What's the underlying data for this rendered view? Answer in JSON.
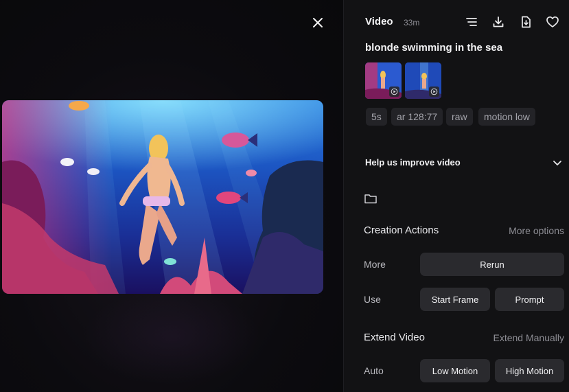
{
  "header": {
    "title": "Video",
    "time": "33m"
  },
  "icons": {
    "close": "close-icon",
    "menu": "lines-icon",
    "download": "download-icon",
    "save": "file-download-icon",
    "like": "heart-icon",
    "folder": "folder-icon",
    "expand": "chevron-down-icon",
    "play": "play-icon"
  },
  "prompt": "blonde swimming in the sea",
  "chips": [
    "5s",
    "ar 128:77",
    "raw",
    "motion low"
  ],
  "feedback": {
    "label": "Help us improve video"
  },
  "creation": {
    "title": "Creation Actions",
    "more_options": "More options",
    "more_label": "More",
    "rerun": "Rerun",
    "use_label": "Use",
    "start_frame": "Start Frame",
    "prompt_btn": "Prompt"
  },
  "extend": {
    "title": "Extend Video",
    "manual": "Extend Manually",
    "auto_label": "Auto",
    "low_motion": "Low Motion",
    "high_motion": "High Motion"
  },
  "colors": {
    "panel_bg": "#121214",
    "button_bg": "#2a2a2e",
    "chip_bg": "#232327",
    "muted_text": "#8d8d94"
  }
}
